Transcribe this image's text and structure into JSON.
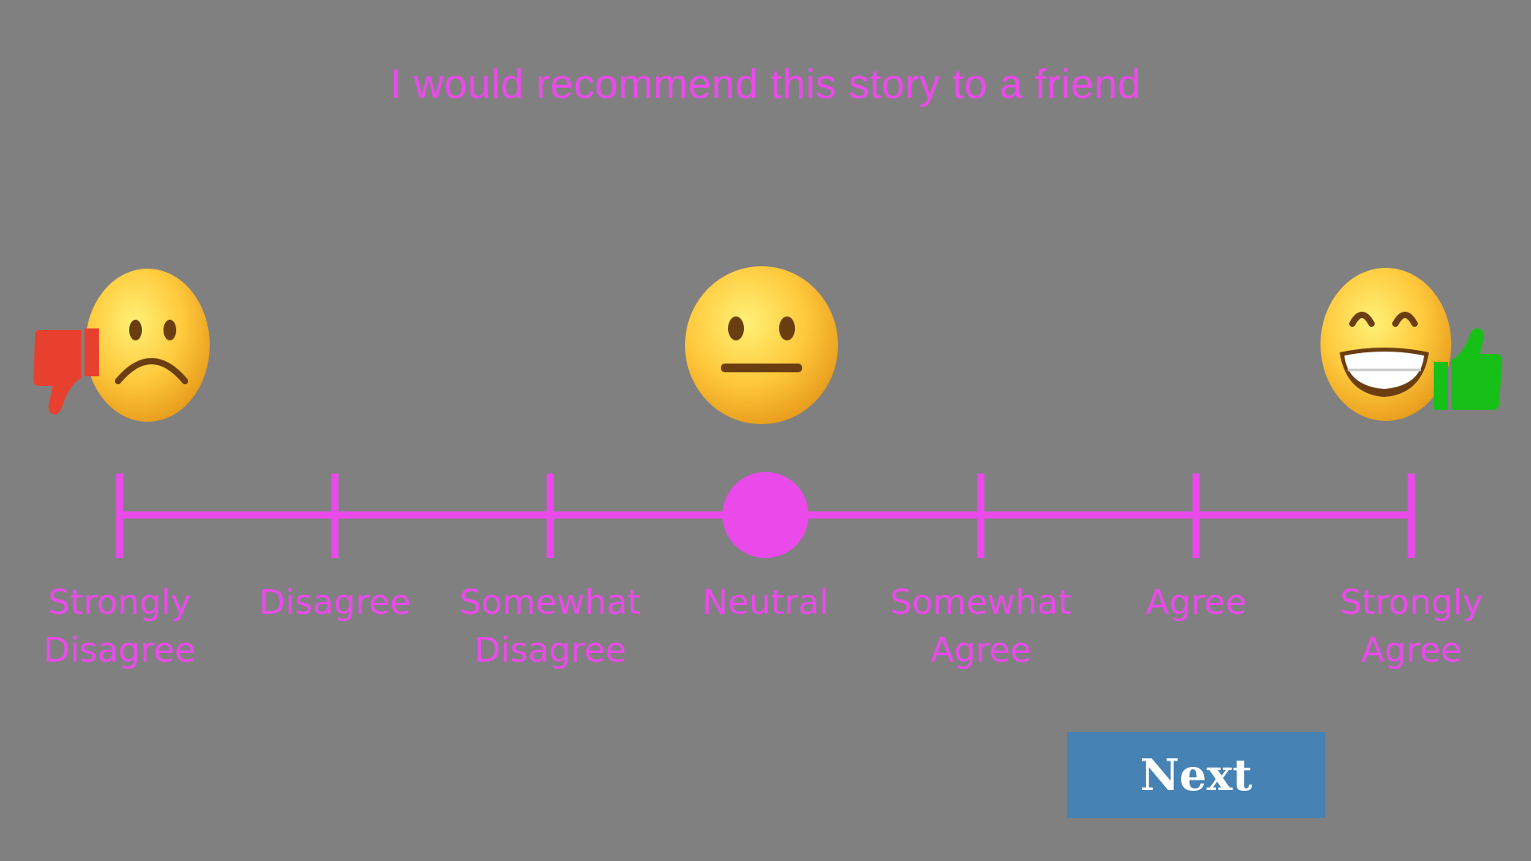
{
  "question": "I would recommend this story to a friend",
  "scale": {
    "options": [
      {
        "line1": "Strongly",
        "line2": "Disagree"
      },
      {
        "line1": "Disagree",
        "line2": ""
      },
      {
        "line1": "Somewhat",
        "line2": "Disagree"
      },
      {
        "line1": "Neutral",
        "line2": ""
      },
      {
        "line1": "Somewhat",
        "line2": "Agree"
      },
      {
        "line1": "Agree",
        "line2": ""
      },
      {
        "line1": "Strongly",
        "line2": "Agree"
      }
    ],
    "selected": "Neutral"
  },
  "icons": {
    "left": "frowning-face-icon",
    "left_badge": "thumbs-down-icon",
    "center": "neutral-face-icon",
    "right": "grinning-face-icon",
    "right_badge": "thumbs-up-icon"
  },
  "colors": {
    "background": "#808080",
    "accent": "#ea4aea",
    "button": "#4682b4",
    "thumbs_down": "#e8402e",
    "thumbs_up": "#17c017"
  },
  "next_button": {
    "label": "Next"
  }
}
